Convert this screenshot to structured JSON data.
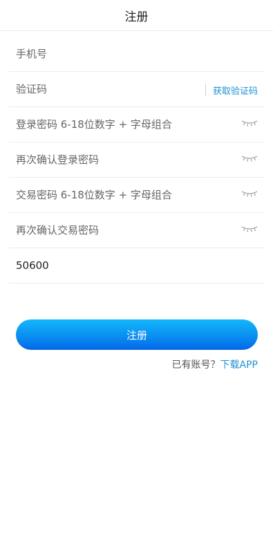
{
  "header": {
    "title": "注册"
  },
  "form": {
    "phone_placeholder": "手机号",
    "code_placeholder": "验证码",
    "get_code_label": "获取验证码",
    "login_password_placeholder": "登录密码 6-18位数字 + 字母组合",
    "login_password_confirm_placeholder": "再次确认登录密码",
    "trade_password_placeholder": "交易密码 6-18位数字 + 字母组合",
    "trade_password_confirm_placeholder": "再次确认交易密码",
    "invite_code_value": "50600"
  },
  "submit": {
    "label": "注册"
  },
  "footer": {
    "have_account_text": "已有账号？",
    "download_label": "下载APP"
  },
  "colors": {
    "accent": "#1e90d4",
    "button_top": "#13b7fb",
    "button_bottom": "#0466e8"
  },
  "icons": {
    "password_toggle": "eye-closed-icon"
  }
}
